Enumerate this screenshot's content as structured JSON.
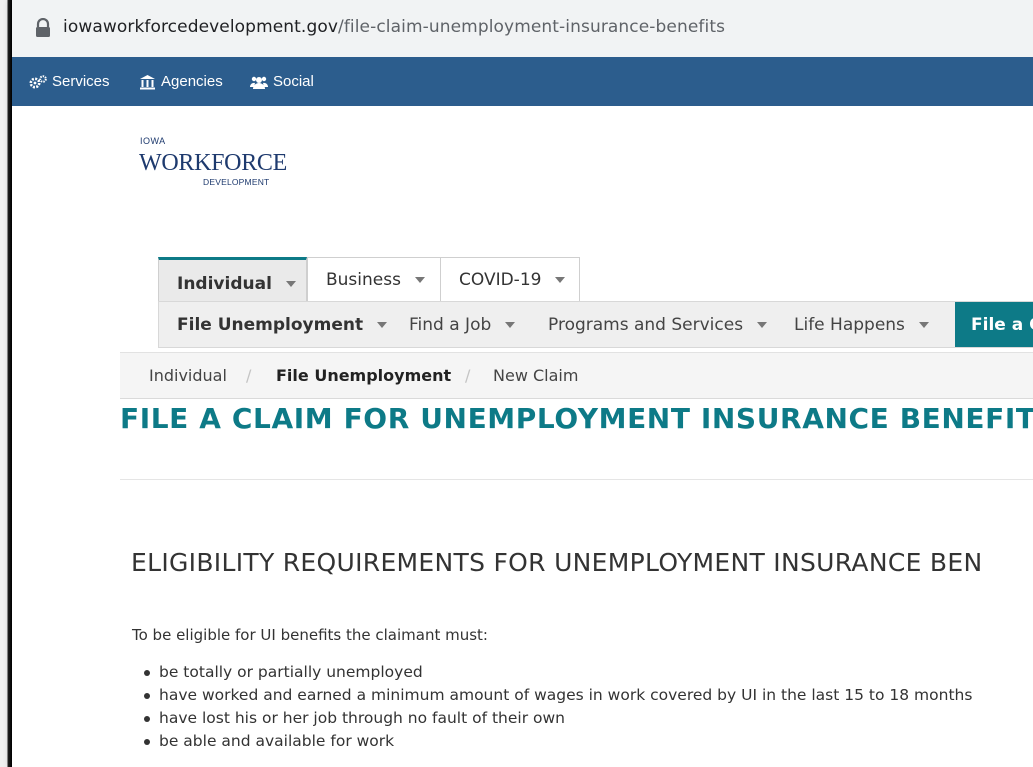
{
  "browser": {
    "url_domain": "iowaworkforcedevelopment.gov",
    "url_path": "/file-claim-unemployment-insurance-benefits"
  },
  "gov_bar": {
    "items": [
      {
        "label": "Services",
        "icon": "gears-icon"
      },
      {
        "label": "Agencies",
        "icon": "building-icon"
      },
      {
        "label": "Social",
        "icon": "users-icon"
      }
    ],
    "color": "#2c5d8d"
  },
  "logo": {
    "top": "IOWA",
    "main": "WORKFORCE",
    "bottom": "DEVELOPMENT",
    "color": "#1e3a6e"
  },
  "tabs": [
    {
      "label": "Individual",
      "active": true
    },
    {
      "label": "Business",
      "active": false
    },
    {
      "label": "COVID-19",
      "active": false
    }
  ],
  "subnav": {
    "items": [
      "File Unemployment",
      "Find a Job",
      "Programs and Services",
      "Life Happens"
    ],
    "cta": "File a Cla",
    "accent": "#0d7a87"
  },
  "breadcrumb": [
    "Individual",
    "File Unemployment",
    "New Claim"
  ],
  "page_title": "FILE A CLAIM FOR UNEMPLOYMENT INSURANCE BENEFITS",
  "section_title": "ELIGIBILITY REQUIREMENTS FOR UNEMPLOYMENT INSURANCE BEN",
  "intro": "To be eligible for UI benefits the claimant must:",
  "requirements": [
    "be totally or partially unemployed",
    "have worked and earned a minimum amount of wages in work covered by UI in the last 15 to 18 months",
    "have lost his or her job through no fault of their own",
    "be able and available for work"
  ]
}
